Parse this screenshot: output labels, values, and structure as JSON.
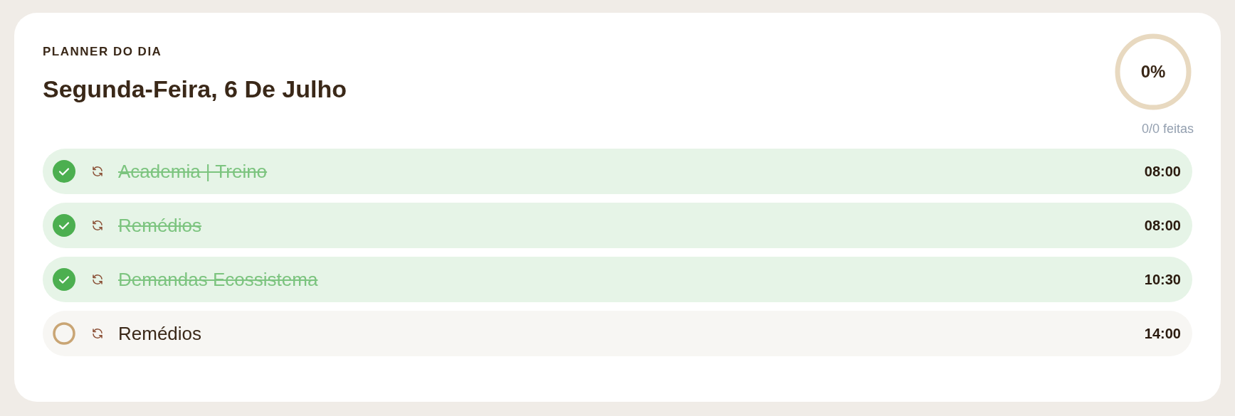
{
  "header": {
    "eyebrow": "PLANNER DO DIA",
    "title": "Segunda-Feira, 6 De Julho"
  },
  "progress": {
    "label": "0%",
    "level": 0,
    "caption": "0/0 feitas"
  },
  "tasks": [
    {
      "title": "Academia | Treino",
      "time": "08:00",
      "checked": true
    },
    {
      "title": "Remédios",
      "time": "08:00",
      "checked": true
    },
    {
      "title": "Demandas Ecossistema",
      "time": "10:30",
      "checked": true
    },
    {
      "title": "Remédios",
      "time": "14:00",
      "checked": false
    }
  ]
}
